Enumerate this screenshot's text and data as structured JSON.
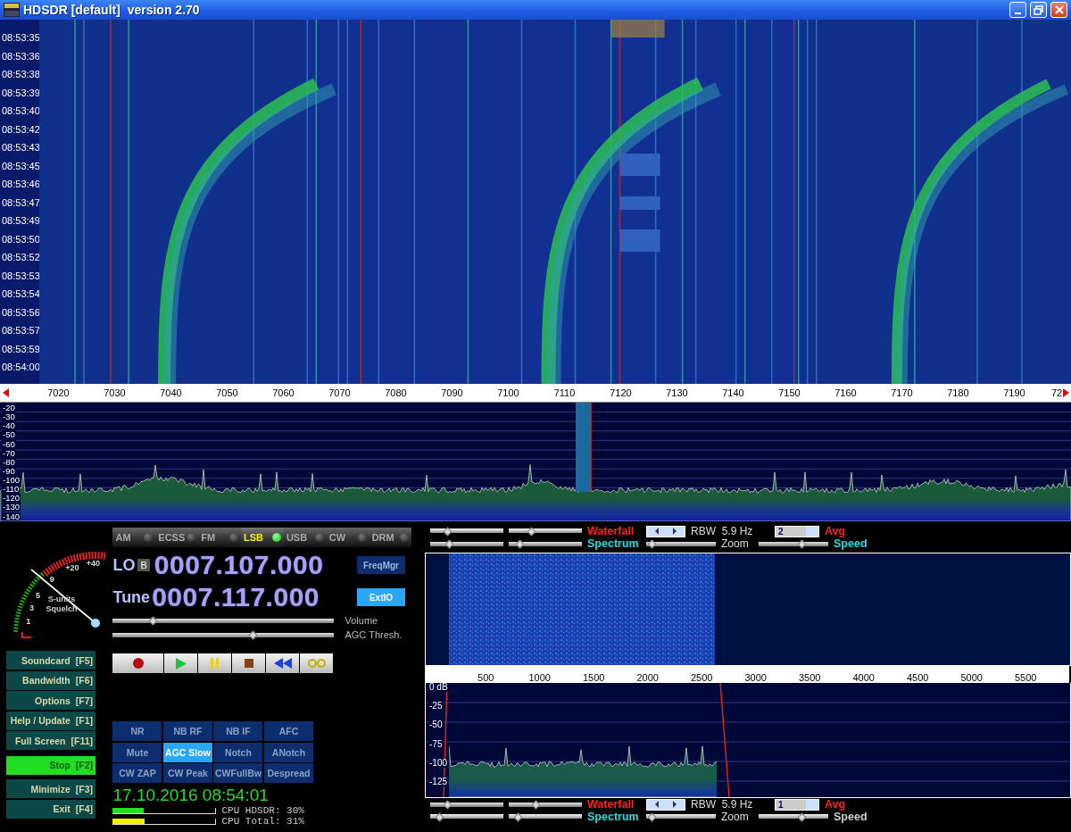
{
  "window": {
    "title": "HDSDR [default]  version 2.70"
  },
  "waterfall": {
    "timestamps": [
      "08:53:35",
      "08:53:36",
      "08:53:38",
      "08:53:39",
      "08:53:40",
      "08:53:42",
      "08:53:43",
      "08:53:45",
      "08:53:46",
      "08:53:47",
      "08:53:49",
      "08:53:50",
      "08:53:52",
      "08:53:53",
      "08:53:54",
      "08:53:56",
      "08:53:57",
      "08:53:59",
      "08:54:00"
    ]
  },
  "frequency_axis": {
    "labels": [
      "7020",
      "7030",
      "7040",
      "7050",
      "7060",
      "7070",
      "7080",
      "7090",
      "7100",
      "7110",
      "7120",
      "7130",
      "7140",
      "7150",
      "7160",
      "7170",
      "7180",
      "7190",
      "72"
    ]
  },
  "spectrum": {
    "db_labels": [
      "-20",
      "-30",
      "-40",
      "-50",
      "-60",
      "-70",
      "-80",
      "-90",
      "-100",
      "-110",
      "-120",
      "-130",
      "-140"
    ]
  },
  "s_meter": {
    "scale_labels": [
      "1",
      "3",
      "5",
      "9",
      "+20",
      "+40"
    ],
    "caption": [
      "S-units",
      "Squelch"
    ]
  },
  "modes": [
    {
      "label": "AM",
      "selected": false
    },
    {
      "label": "ECSS",
      "selected": false
    },
    {
      "label": "FM",
      "selected": false
    },
    {
      "label": "LSB",
      "selected": true
    },
    {
      "label": "USB",
      "selected": false
    },
    {
      "label": "CW",
      "selected": false
    },
    {
      "label": "DRM",
      "selected": false
    }
  ],
  "lo": {
    "label": "LO",
    "bank": "B",
    "frequency": "0007.107.000"
  },
  "tune": {
    "label": "Tune",
    "frequency": "0007.117.000"
  },
  "side_buttons": [
    {
      "label": "FreqMgr",
      "active": false
    },
    {
      "label": "ExtIO",
      "active": true
    }
  ],
  "sliders": [
    {
      "label": "Volume",
      "level": 0.17
    },
    {
      "label": "AGC Thresh.",
      "level": 0.64
    }
  ],
  "transport": [
    {
      "kind": "record"
    },
    {
      "kind": "play"
    },
    {
      "kind": "pause"
    },
    {
      "kind": "stop"
    },
    {
      "kind": "rewind"
    },
    {
      "kind": "loop"
    }
  ],
  "function_keys": [
    {
      "label": "Soundcard",
      "key": "[F5]",
      "active": false
    },
    {
      "label": "Bandwidth",
      "key": "[F6]",
      "active": false
    },
    {
      "label": "Options",
      "key": "[F7]",
      "active": false
    },
    {
      "label": "Help / Update",
      "key": "[F1]",
      "active": false
    },
    {
      "label": "Full Screen",
      "key": "[F11]",
      "active": false
    },
    {
      "label": "Stop",
      "key": "[F2]",
      "active": true
    },
    {
      "label": "Minimize",
      "key": "[F3]",
      "active": false
    },
    {
      "label": "Exit",
      "key": "[F4]",
      "active": false
    }
  ],
  "dsp_buttons": [
    {
      "label": "NR",
      "on": false
    },
    {
      "label": "NB RF",
      "on": false
    },
    {
      "label": "NB IF",
      "on": false
    },
    {
      "label": "AFC",
      "on": false
    },
    {
      "label": "Mute",
      "on": false
    },
    {
      "label": "AGC Slow",
      "on": true
    },
    {
      "label": "Notch",
      "on": false
    },
    {
      "label": "ANotch",
      "on": false
    },
    {
      "label": "CW ZAP",
      "on": false
    },
    {
      "label": "CW Peak",
      "on": false
    },
    {
      "label": "CWFullBw",
      "on": false
    },
    {
      "label": "Despread",
      "on": false
    }
  ],
  "clock": "17.10.2016 08:54:01",
  "cpu": [
    {
      "label": "CPU HDSDR: 30%",
      "level": 0.3
    },
    {
      "label": "CPU Total: 31%",
      "level": 0.31
    }
  ],
  "audio_controls": [
    {
      "waterfall_sliders": [
        {
          "level": 0.2
        },
        {
          "level": 0.28
        }
      ],
      "waterfall_label": "Waterfall",
      "rbw": "RBW  5.9 Hz",
      "avg_value": "2",
      "avg_label": "Avg",
      "spectrum_sliders": [
        {
          "level": 0.23
        },
        {
          "level": 0.1
        }
      ],
      "spectrum_label": "Spectrum",
      "zoom": {
        "level": 0.02
      },
      "zoom_label": "Zoom",
      "speed": {
        "level": 0.64
      },
      "speed_label": "Speed",
      "speed_highlighted": true
    },
    {
      "waterfall_sliders": [
        {
          "level": 0.2
        },
        {
          "level": 0.36
        }
      ],
      "waterfall_label": "Waterfall",
      "rbw": "RBW  5.9 Hz",
      "avg_value": "1",
      "avg_label": "Avg",
      "spectrum_sliders": [
        {
          "level": 0.08
        },
        {
          "level": 0.08
        }
      ],
      "spectrum_label": "Spectrum",
      "zoom": {
        "level": 0.02
      },
      "zoom_label": "Zoom",
      "speed": {
        "level": 0.64
      },
      "speed_label": "Speed",
      "speed_highlighted": false
    }
  ],
  "audio_axis": {
    "labels": [
      "500",
      "1000",
      "1500",
      "2000",
      "2500",
      "3000",
      "3500",
      "4000",
      "4500",
      "5000",
      "5500"
    ]
  },
  "audio_spectrum": {
    "db_labels": [
      "0 dB",
      "-25",
      "-50",
      "-75",
      "-100",
      "-125"
    ]
  }
}
